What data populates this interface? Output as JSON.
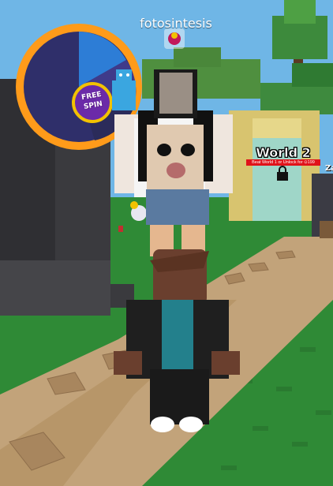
{
  "player": {
    "name": "fotosintesis"
  },
  "world": {
    "title": "World 2",
    "unlock_text": "Beat World 1 or Unlock for",
    "unlock_price": "199",
    "lock_icon": "lock-icon"
  },
  "spin_wheel": {
    "label_line1": "FREE",
    "label_line2": "SPIN"
  },
  "edge_label": "Za",
  "colors": {
    "sky": "#6fb6e6",
    "grass": "#2f8a36",
    "path": "#c2a37a",
    "wheel_purple": "#6b2aa8",
    "unlock_red": "#e0121a"
  }
}
